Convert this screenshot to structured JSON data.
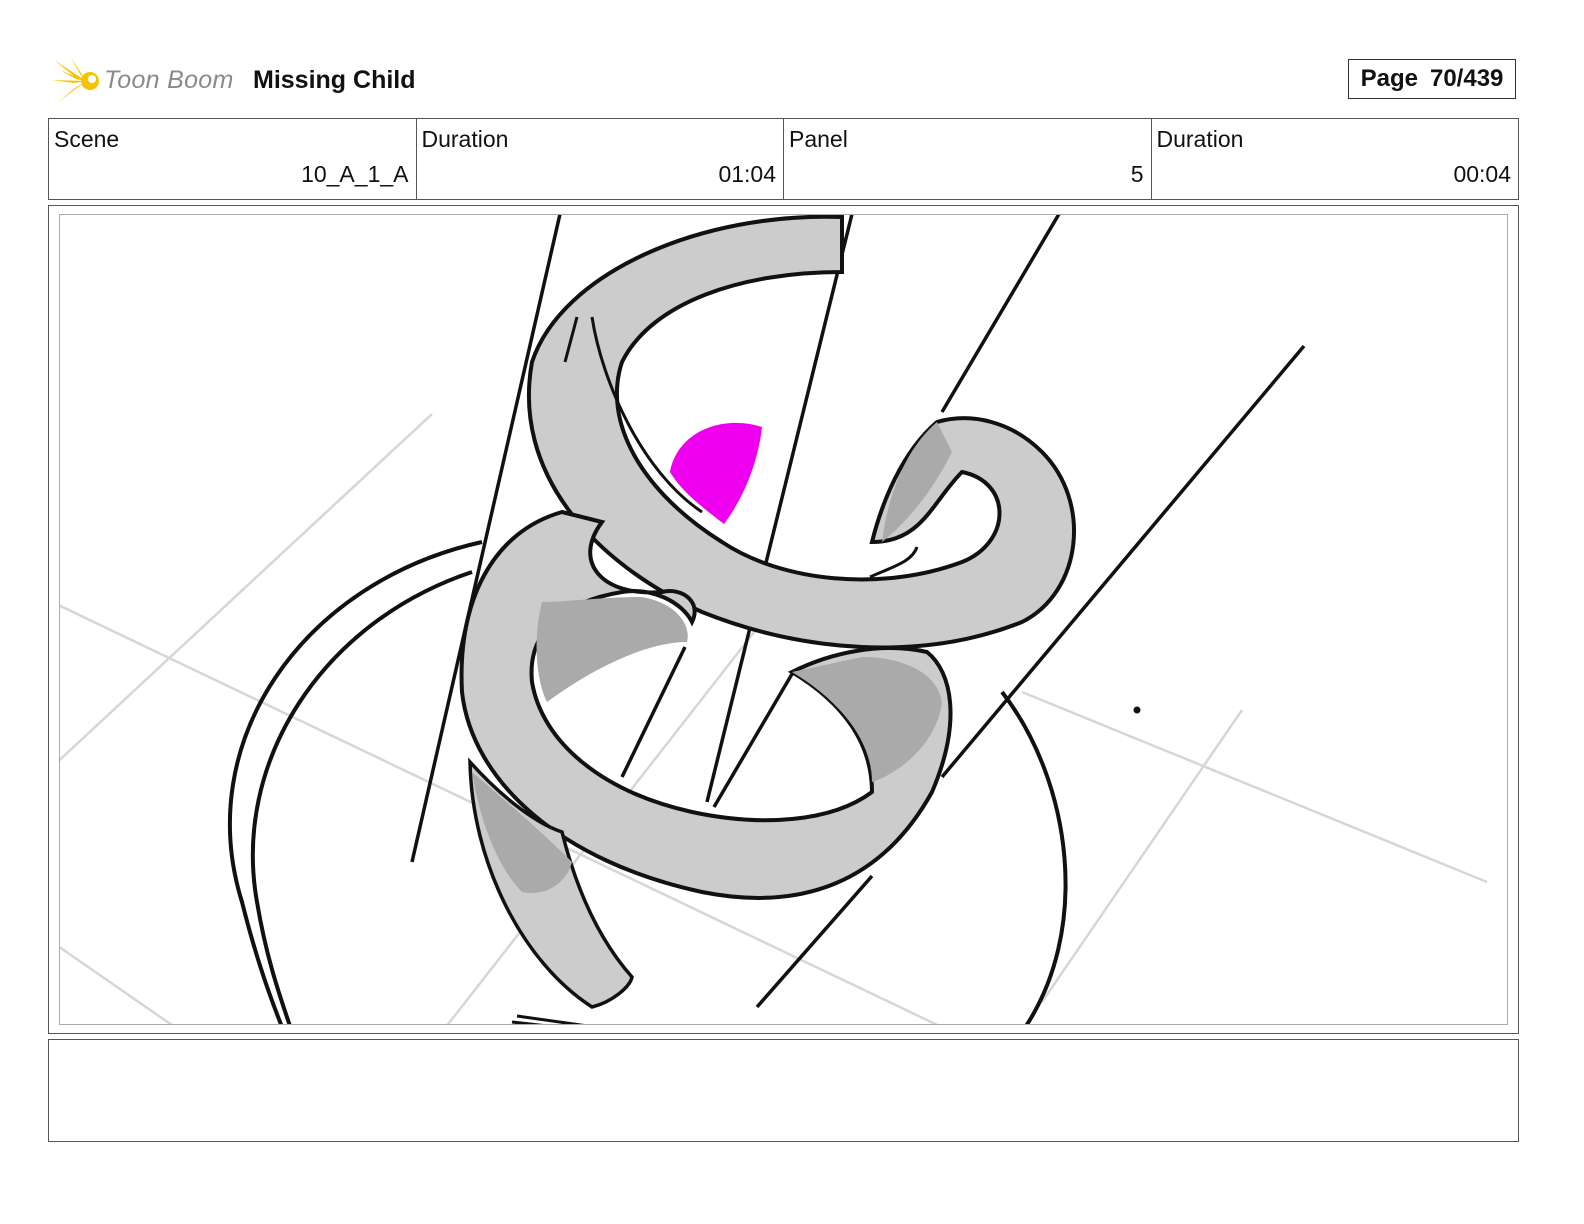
{
  "header": {
    "logo_text": "Toon Boom",
    "project_title": "Missing Child",
    "page_label": "Page",
    "page_value": "70/439"
  },
  "info": {
    "scene_label": "Scene",
    "scene_value": "10_A_1_A",
    "scene_duration_label": "Duration",
    "scene_duration_value": "01:04",
    "panel_label": "Panel",
    "panel_value": "5",
    "panel_duration_label": "Duration",
    "panel_duration_value": "00:04"
  },
  "colors": {
    "logo_star": "#f5c400",
    "sketch_fill": "#cccccc",
    "sketch_shadow": "#aaaaaa",
    "highlight": "#ee00ee"
  }
}
